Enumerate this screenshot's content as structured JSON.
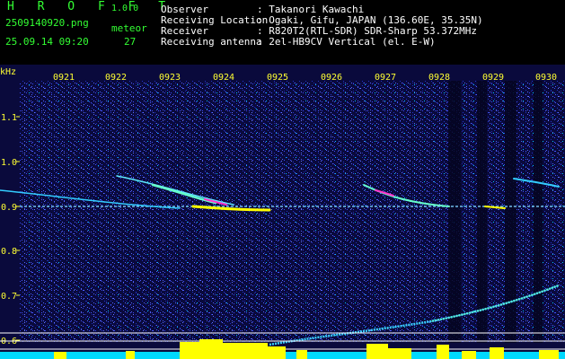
{
  "header": {
    "app_name": "H R O F F T",
    "app_version": "1.0.0",
    "file_name": "2509140920.png",
    "date_time": "25.09.14 09:20",
    "meteor_label": "meteor",
    "meteor_count": "27",
    "info": [
      {
        "key": "Observer",
        "value": ": Takanori Kawachi"
      },
      {
        "key": "Receiving Location",
        "value": ": Ogaki, Gifu, JAPAN (136.60E, 35.35N)"
      },
      {
        "key": "Receiver",
        "value": ": R820T2(RTL-SDR) SDR-Sharp 53.372MHz"
      },
      {
        "key": "Receiving antenna",
        "value": ": 2el-HB9CV Vertical (el. E-W)"
      }
    ]
  },
  "spectrogram": {
    "unit_label": "kHz",
    "time_labels": [
      "0921",
      "0922",
      "0923",
      "0924",
      "0925",
      "0926",
      "0927",
      "0928",
      "0929",
      "0930"
    ],
    "freq_labels": [
      "1.1",
      "1.0",
      "0.9",
      "0.8",
      "0.7",
      "0.6"
    ],
    "colors": {
      "background": "#0a0a3c",
      "noise": "#2b3bd0",
      "text": "#ffff33",
      "signal_yellow": "#ffff00",
      "signal_cyan": "#00e5ff",
      "grid": "#ffffff"
    }
  }
}
